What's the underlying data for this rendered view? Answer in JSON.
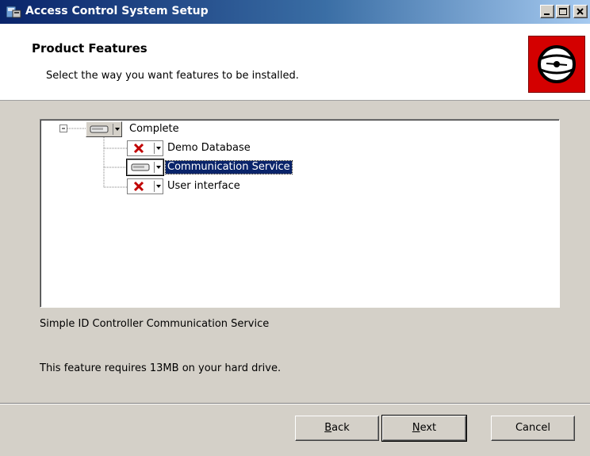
{
  "window": {
    "title": "Access Control System Setup",
    "colors": {
      "title_gradient_start": "#0a246a",
      "title_gradient_end": "#a6caf0",
      "brand": "#d40000"
    }
  },
  "header": {
    "title": "Product Features",
    "subtitle": "Select the way you want features to be installed."
  },
  "tree": {
    "root": {
      "label": "Complete",
      "state_icon": "drive-icon"
    },
    "children": [
      {
        "label": "Demo Database",
        "state_icon": "x-icon"
      },
      {
        "label": "Communication Service",
        "state_icon": "drive-icon",
        "selected": true
      },
      {
        "label": "User interface",
        "state_icon": "x-icon"
      }
    ]
  },
  "details": {
    "description": "Simple ID Controller Communication Service",
    "requirement": "This feature requires 13MB on your hard drive."
  },
  "buttons": {
    "back": {
      "prefix": "",
      "accel": "B",
      "rest": "ack"
    },
    "next": {
      "prefix": "",
      "accel": "N",
      "rest": "ext"
    },
    "cancel": "Cancel"
  }
}
